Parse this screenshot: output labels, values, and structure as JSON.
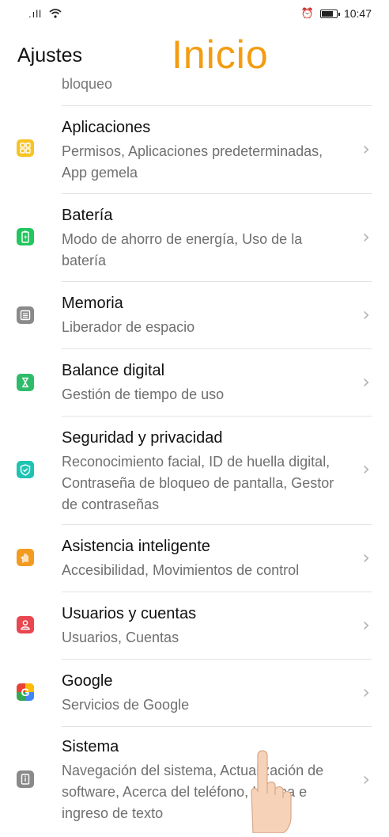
{
  "statusbar": {
    "signal": ".ıll",
    "wifi": "wifi-icon",
    "alarm": "⏰",
    "time": "10:47"
  },
  "header": {
    "title": "Ajustes",
    "watermark": "Inicio"
  },
  "clipped_item": {
    "subtitle": "bloqueo"
  },
  "items": [
    {
      "title": "Aplicaciones",
      "subtitle": "Permisos, Aplicaciones predeterminadas, App gemela",
      "icon": "apps-icon",
      "color": "#f7c325"
    },
    {
      "title": "Batería",
      "subtitle": "Modo de ahorro de energía, Uso de la batería",
      "icon": "battery-icon",
      "color": "#22c55e"
    },
    {
      "title": "Memoria",
      "subtitle": "Liberador de espacio",
      "icon": "storage-icon",
      "color": "#8a8a8a"
    },
    {
      "title": "Balance digital",
      "subtitle": "Gestión de tiempo de uso",
      "icon": "hourglass-icon",
      "color": "#2ebc6a"
    },
    {
      "title": "Seguridad y privacidad",
      "subtitle": "Reconocimiento facial, ID de huella digital, Contraseña de bloqueo de pantalla, Gestor de contraseñas",
      "icon": "shield-icon",
      "color": "#1fc3b3"
    },
    {
      "title": "Asistencia inteligente",
      "subtitle": "Accesibilidad, Movimientos de control",
      "icon": "hand-icon",
      "color": "#f39b20"
    },
    {
      "title": "Usuarios y cuentas",
      "subtitle": "Usuarios, Cuentas",
      "icon": "user-icon",
      "color": "#e9474f"
    },
    {
      "title": "Google",
      "subtitle": "Servicios de Google",
      "icon": "google-icon",
      "color": "#4285f4"
    },
    {
      "title": "Sistema",
      "subtitle": "Navegación del sistema, Actualización de software, Acerca del teléfono, Idioma e ingreso de texto",
      "icon": "system-icon",
      "color": "#8a8a8a"
    }
  ]
}
